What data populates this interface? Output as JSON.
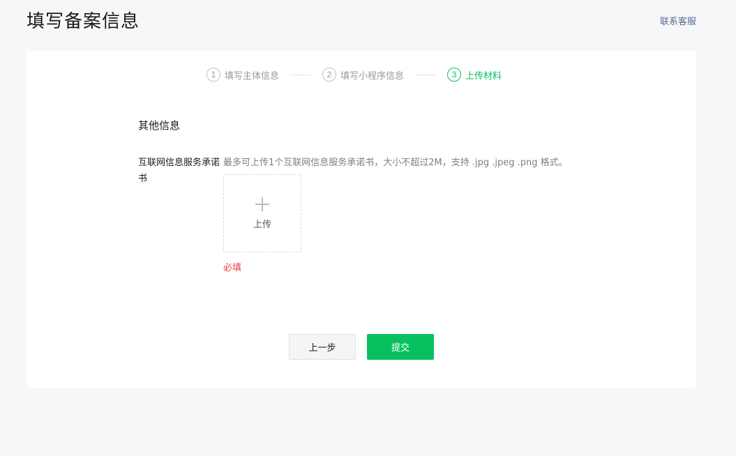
{
  "header": {
    "title": "填写备案信息",
    "contact_link": "联系客服"
  },
  "steps": [
    {
      "number": "1",
      "label": "填写主体信息",
      "state": "done"
    },
    {
      "number": "2",
      "label": "填写小程序信息",
      "state": "done"
    },
    {
      "number": "3",
      "label": "上传材料",
      "state": "active"
    }
  ],
  "form": {
    "section_title": "其他信息",
    "field_label": "互联网信息服务承诺书",
    "field_tip": "最多可上传1个互联网信息服务承诺书，大小不超过2M，支持 .jpg .jpeg .png 格式。",
    "upload_label": "上传",
    "required_error": "必填"
  },
  "actions": {
    "prev_label": "上一步",
    "submit_label": "提交"
  },
  "colors": {
    "accent": "#07c160",
    "error": "#e64340",
    "link": "#576b95"
  }
}
